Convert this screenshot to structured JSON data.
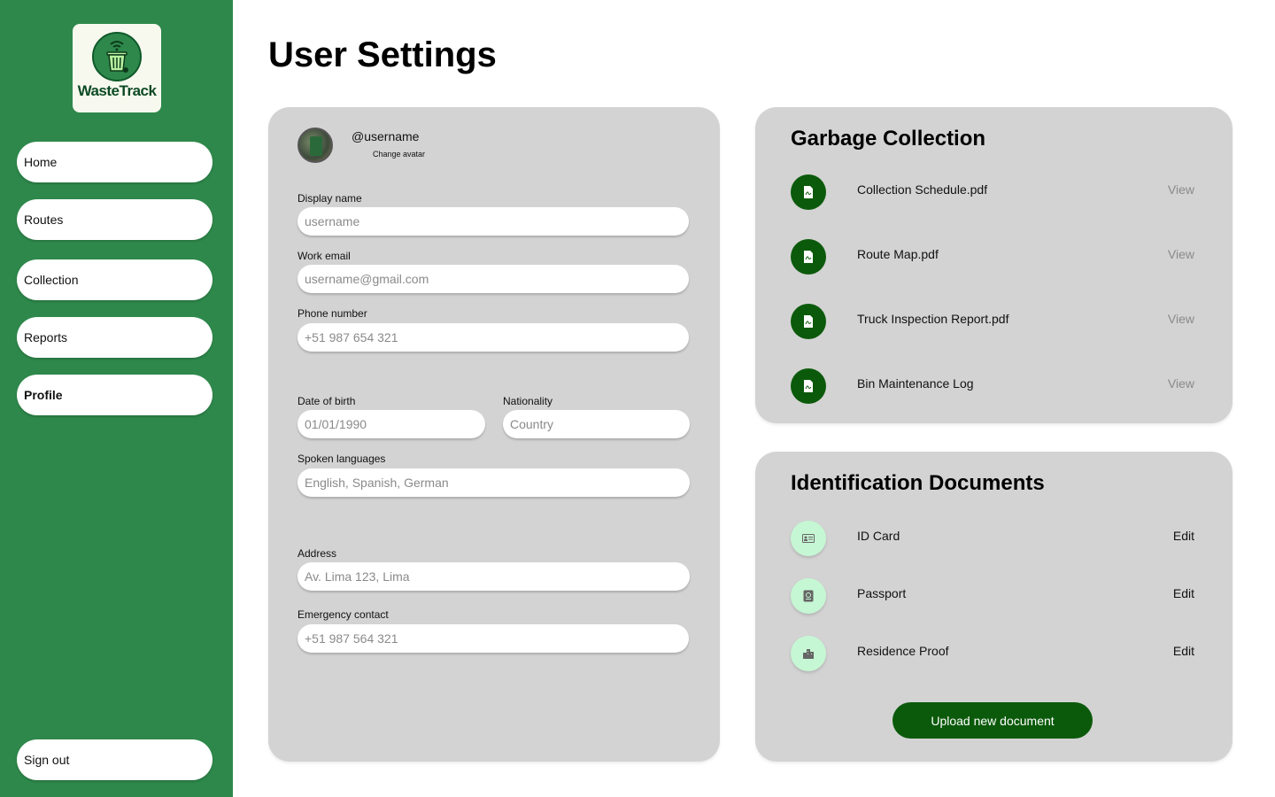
{
  "app": {
    "name": "WasteTrack"
  },
  "sidebar": {
    "items": [
      {
        "label": "Home"
      },
      {
        "label": "Routes"
      },
      {
        "label": "Collection"
      },
      {
        "label": "Reports"
      },
      {
        "label": "Profile",
        "active": true
      }
    ],
    "sign_out": "Sign out"
  },
  "page": {
    "title": "User Settings"
  },
  "profile": {
    "username": "@username",
    "change_avatar": "Change avatar",
    "fields": {
      "display_name": {
        "label": "Display name",
        "placeholder": "username"
      },
      "work_email": {
        "label": "Work email",
        "placeholder": "username@gmail.com"
      },
      "phone": {
        "label": "Phone number",
        "placeholder": "+51 987 654 321"
      },
      "dob": {
        "label": "Date of birth",
        "placeholder": "01/01/1990"
      },
      "nationality": {
        "label": "Nationality",
        "placeholder": "Country"
      },
      "languages": {
        "label": "Spoken languages",
        "placeholder": "English, Spanish, German"
      },
      "address": {
        "label": "Address",
        "placeholder": "Av. Lima 123, Lima"
      },
      "emergency": {
        "label": "Emergency contact",
        "placeholder": "+51 987 564 321"
      }
    }
  },
  "garbage_collection": {
    "title": "Garbage Collection",
    "documents": [
      {
        "name": "Collection Schedule.pdf",
        "action": "View",
        "icon": "pdf-file-icon"
      },
      {
        "name": "Route Map.pdf",
        "action": "View",
        "icon": "pdf-file-icon"
      },
      {
        "name": "Truck Inspection Report.pdf",
        "action": "View",
        "icon": "pdf-file-icon"
      },
      {
        "name": "Bin Maintenance Log",
        "action": "View",
        "icon": "pdf-file-icon"
      }
    ]
  },
  "identification": {
    "title": "Identification Documents",
    "documents": [
      {
        "name": "ID Card",
        "action": "Edit",
        "icon": "id-card-icon"
      },
      {
        "name": "Passport",
        "action": "Edit",
        "icon": "passport-icon"
      },
      {
        "name": "Residence Proof",
        "action": "Edit",
        "icon": "building-icon"
      }
    ],
    "upload_label": "Upload new document"
  },
  "colors": {
    "sidebar": "#2e884b",
    "accent_dark": "#0b5a0b",
    "accent_light": "#c6f7d4",
    "card": "#d3d3d3"
  }
}
